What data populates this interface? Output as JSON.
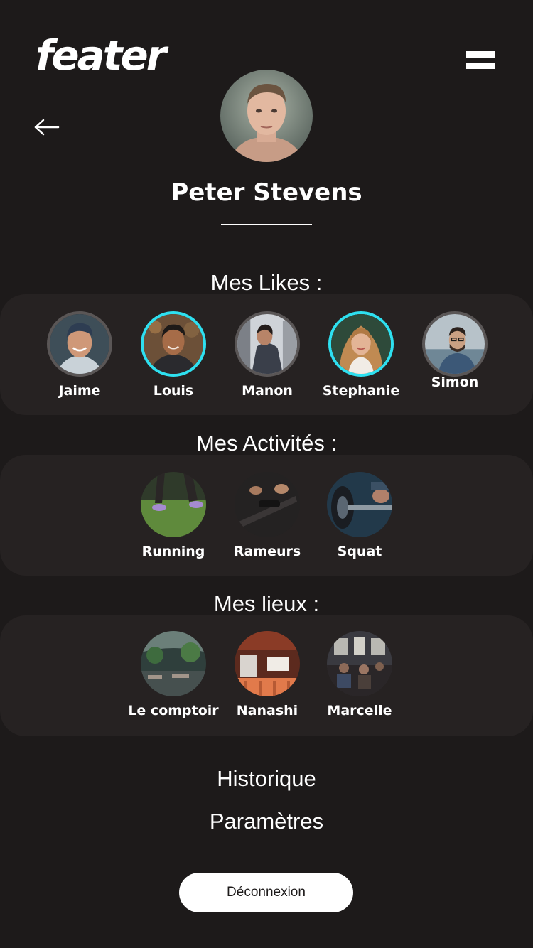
{
  "app": {
    "logo": "feater"
  },
  "header": {
    "menu_icon": "hamburger-menu-icon",
    "back_icon": "arrow-left-icon"
  },
  "profile": {
    "name": "Peter Stevens"
  },
  "likes": {
    "title": "Mes Likes :",
    "items": [
      {
        "label": "Jaime",
        "ring": "grey"
      },
      {
        "label": "Louis",
        "ring": "cyan"
      },
      {
        "label": "Manon",
        "ring": "grey"
      },
      {
        "label": "Stephanie",
        "ring": "cyan"
      },
      {
        "label": "Simon",
        "ring": "grey"
      }
    ]
  },
  "activities": {
    "title": "Mes Activités :",
    "items": [
      {
        "label": "Running"
      },
      {
        "label": "Rameurs"
      },
      {
        "label": "Squat"
      }
    ]
  },
  "places": {
    "title": "Mes lieux :",
    "items": [
      {
        "label": "Le comptoir"
      },
      {
        "label": "Nanashi"
      },
      {
        "label": "Marcelle"
      }
    ]
  },
  "menu": {
    "history": "Historique",
    "settings": "Paramètres",
    "logout": "Déconnexion"
  },
  "colors": {
    "background": "#1d1a1a",
    "panel": "#262222",
    "accent_ring": "#2ee0f0",
    "default_ring": "#5a5656",
    "text": "#ffffff"
  }
}
